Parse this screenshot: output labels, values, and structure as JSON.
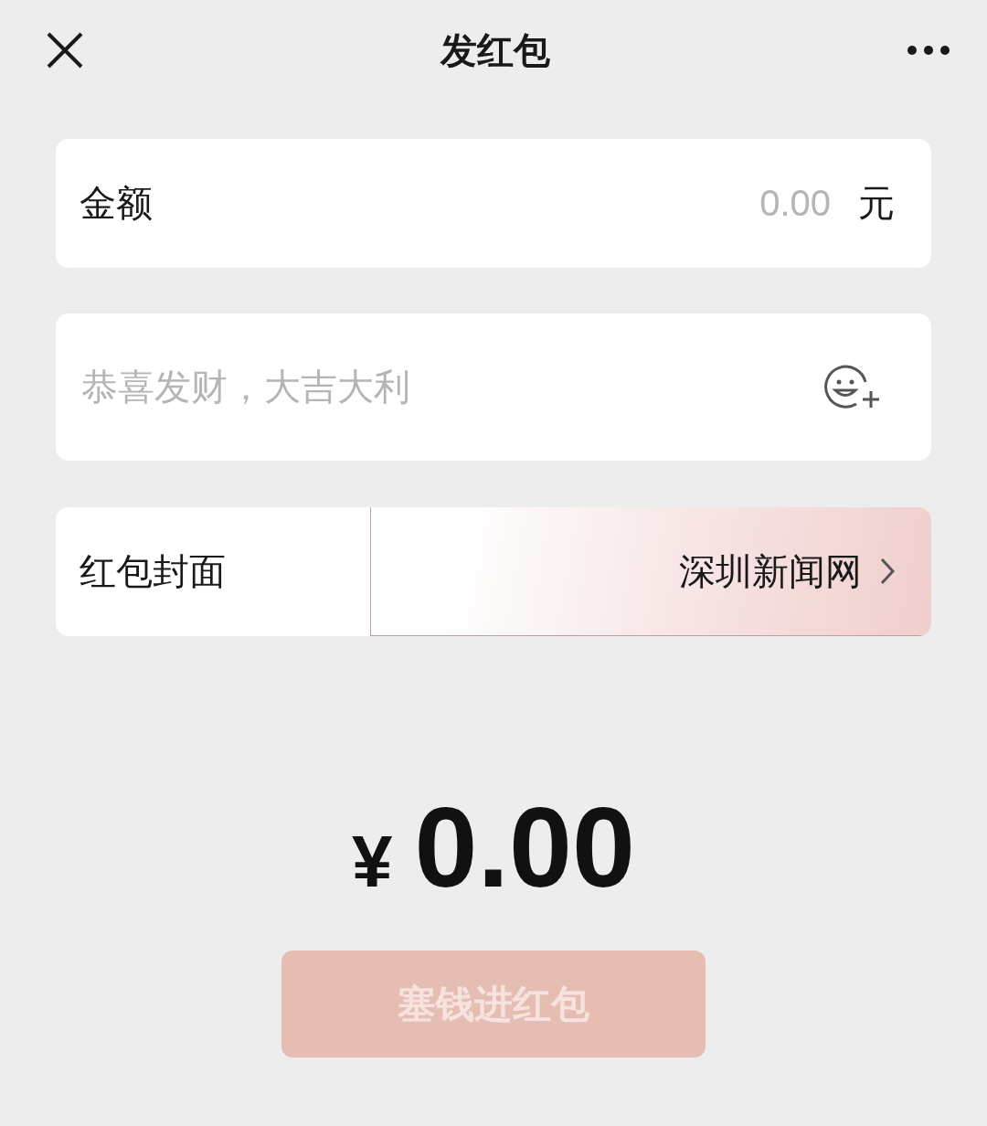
{
  "header": {
    "title": "发红包"
  },
  "amount_field": {
    "label": "金额",
    "placeholder": "0.00",
    "unit": "元"
  },
  "greeting_field": {
    "placeholder": "恭喜发财，大吉大利"
  },
  "cover_row": {
    "label": "红包封面",
    "value": "深圳新闻网"
  },
  "total": {
    "currency": "¥",
    "amount": "0.00"
  },
  "submit_button": {
    "label": "塞钱进红包",
    "disabled": true
  }
}
